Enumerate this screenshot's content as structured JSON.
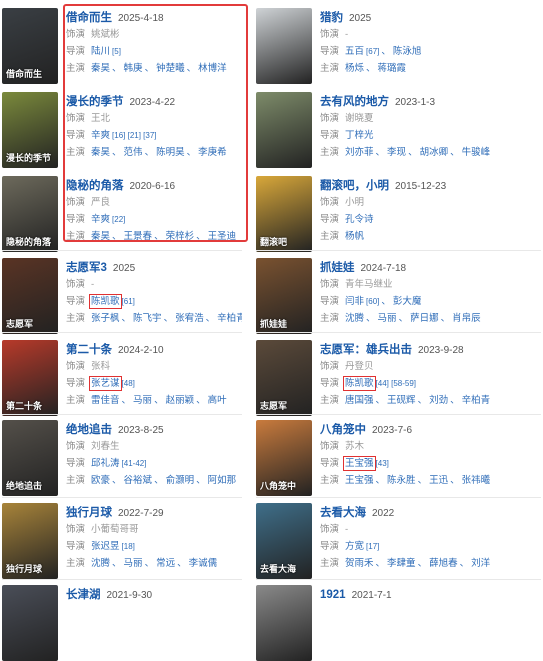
{
  "colors": {
    "title": "#1b5aa8",
    "link": "#2f6db8",
    "highlight": "#e03131"
  },
  "labels": {
    "voiced": "饰演",
    "director": "导演",
    "cast": "主演"
  },
  "left": [
    {
      "title": "借命而生",
      "year": "2025-4-18",
      "voiced": "姚斌彬",
      "director": "陆川",
      "director_ref": "[5]",
      "cast": [
        "秦昊",
        "韩庚",
        "钟楚曦",
        "林博洋"
      ],
      "poster_text": "借命而生",
      "poster_color": "#3a3f44"
    },
    {
      "title": "漫长的季节",
      "year": "2023-4-22",
      "voiced": "王北",
      "director": "辛爽",
      "director_ref": "[16] [21] [37]",
      "cast": [
        "秦昊",
        "范伟",
        "陈明昊",
        "李庚希"
      ],
      "poster_text": "漫长的季节",
      "poster_color": "#7b8a3c"
    },
    {
      "title": "隐秘的角落",
      "year": "2020-6-16",
      "voiced": "严良",
      "director": "辛爽",
      "director_ref": "[22]",
      "cast": [
        "秦昊",
        "王景春",
        "荣梓杉",
        "王圣迪"
      ],
      "poster_text": "隐秘的角落",
      "poster_color": "#6d6a5c"
    },
    {
      "title": "志愿军3",
      "year": "2025",
      "voiced": "-",
      "director": "陈凯歌",
      "director_ref": "[61]",
      "cast": [
        "张子枫",
        "陈飞宇",
        "张宥浩",
        "辛柏青"
      ],
      "poster_text": "志愿军",
      "poster_color": "#5a3424"
    },
    {
      "title": "第二十条",
      "year": "2024-2-10",
      "voiced": "张科",
      "director": "张艺谋",
      "director_ref": "[48]",
      "cast": [
        "雷佳音",
        "马丽",
        "赵丽颖",
        "高叶"
      ],
      "poster_text": "第二十条",
      "poster_color": "#b83a2a"
    },
    {
      "title": "绝地追击",
      "year": "2023-8-25",
      "voiced": "刘春生",
      "director": "邱礼涛",
      "director_ref": "[41-42]",
      "cast": [
        "欧豪",
        "谷裕斌",
        "俞灏明",
        "阿如那"
      ],
      "poster_text": "绝地追击",
      "poster_color": "#54504a"
    },
    {
      "title": "独行月球",
      "year": "2022-7-29",
      "voiced": "小葡萄哥哥",
      "director": "张迟昱",
      "director_ref": "[18]",
      "cast": [
        "沈腾",
        "马丽",
        "常远",
        "李诚儒"
      ],
      "poster_text": "独行月球",
      "poster_color": "#a8843a"
    },
    {
      "title": "长津湖",
      "year": "2021-9-30",
      "voiced": "",
      "director": "",
      "director_ref": "",
      "cast": [],
      "poster_text": "",
      "poster_color": "#4a4e58"
    }
  ],
  "right": [
    {
      "title": "猎豹",
      "year": "2025",
      "voiced": "-",
      "director": "五百",
      "director_ref": "[67]",
      "director2": "陈泳旭",
      "cast": [
        "杨烁",
        "蒋璐霞"
      ],
      "poster_text": "",
      "poster_color": "#cfd3d6"
    },
    {
      "title": "去有风的地方",
      "year": "2023-1-3",
      "voiced": "谢晓夏",
      "director": "丁梓光",
      "director_ref": "",
      "cast": [
        "刘亦菲",
        "李现",
        "胡冰卿",
        "牛骏峰"
      ],
      "poster_text": "",
      "poster_color": "#7e8c6a"
    },
    {
      "title": "翻滚吧，小明",
      "year": "2015-12-23",
      "voiced": "小明",
      "director": "孔令诗",
      "director_ref": "",
      "cast": [
        "杨帆"
      ],
      "poster_text": "翻滚吧",
      "poster_color": "#d9a83a"
    },
    {
      "title": "抓娃娃",
      "year": "2024-7-18",
      "voiced": "青年马继业",
      "director": "闫非",
      "director_ref": "[60]",
      "director2": "彭大魔",
      "cast": [
        "沈腾",
        "马丽",
        "萨日娜",
        "肖帛辰"
      ],
      "poster_text": "抓娃娃",
      "poster_color": "#7a5230"
    },
    {
      "title": "志愿军：雄兵出击",
      "year": "2023-9-28",
      "voiced": "丹登贝",
      "director": "陈凯歌",
      "director_ref": "[44] [58-59]",
      "cast": [
        "唐国强",
        "王砚辉",
        "刘劲",
        "辛柏青"
      ],
      "poster_text": "志愿军",
      "poster_color": "#5b4a3a"
    },
    {
      "title": "八角笼中",
      "year": "2023-7-6",
      "voiced": "苏木",
      "director": "王宝强",
      "director_ref": "[43]",
      "cast": [
        "王宝强",
        "陈永胜",
        "王迅",
        "张祎曦"
      ],
      "poster_text": "八角笼中",
      "poster_color": "#c97b3d"
    },
    {
      "title": "去看大海",
      "year": "2022",
      "voiced": "-",
      "director": "方宽",
      "director_ref": "[17]",
      "cast": [
        "贺雨禾",
        "李肆童",
        "薛旭春",
        "刘洋"
      ],
      "poster_text": "去看大海",
      "poster_color": "#3f6f8a"
    },
    {
      "title": "1921",
      "year": "2021-7-1",
      "voiced": "",
      "director": "",
      "director_ref": "",
      "cast": [],
      "poster_text": "",
      "poster_color": "#8a8a8a"
    }
  ]
}
